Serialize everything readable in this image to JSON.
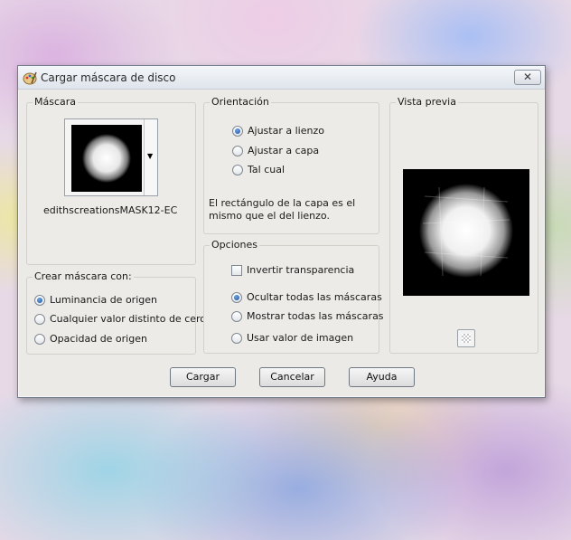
{
  "dialog": {
    "title": "Cargar máscara de disco",
    "close_label": "✕"
  },
  "mask": {
    "group_title": "Máscara",
    "name": "edithscreationsMASK12-EC",
    "dropdown_arrow": "▼"
  },
  "create_with": {
    "group_title": "Crear máscara con:",
    "options": [
      "Luminancia de origen",
      "Cualquier valor distinto de cero",
      "Opacidad de origen"
    ],
    "selected": 0
  },
  "orientation": {
    "group_title": "Orientación",
    "options": [
      "Ajustar a lienzo",
      "Ajustar a capa",
      "Tal cual"
    ],
    "selected": 0,
    "note": "El rectángulo de la capa es el mismo que el del lienzo."
  },
  "options": {
    "group_title": "Opciones",
    "invert_label": "Invertir transparencia",
    "invert_checked": false,
    "visibility_options": [
      "Ocultar todas las máscaras",
      "Mostrar todas las máscaras",
      "Usar valor de imagen"
    ],
    "selected": 0
  },
  "preview": {
    "group_title": "Vista previa",
    "icon": "checkerboard-icon"
  },
  "buttons": {
    "load": "Cargar",
    "cancel": "Cancelar",
    "help": "Ayuda"
  }
}
